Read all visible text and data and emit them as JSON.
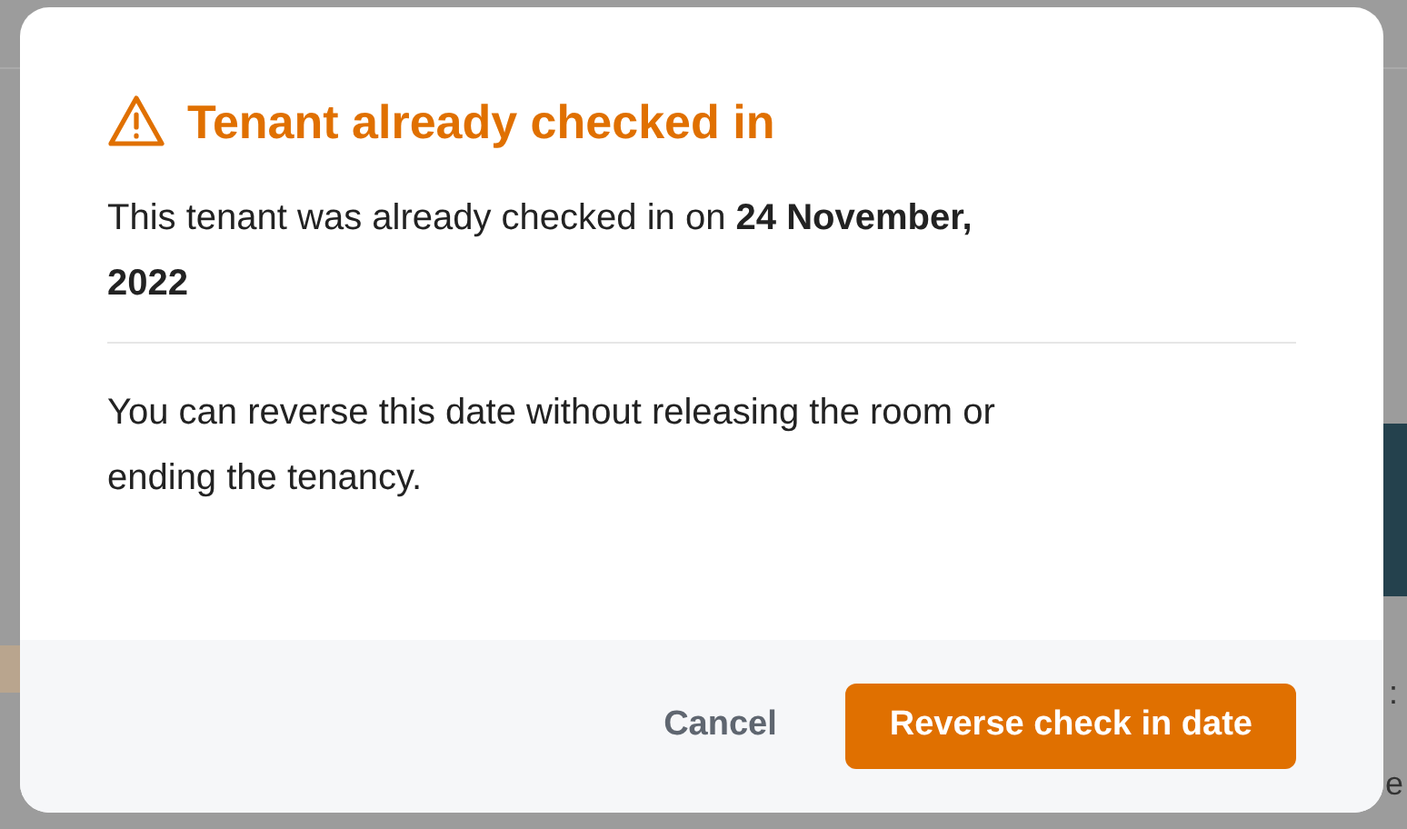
{
  "background": {
    "fragments_right": [
      {
        "text": ":",
        "kind": "plain"
      },
      {
        "text": "e",
        "kind": "plain"
      }
    ]
  },
  "dialog": {
    "title": "Tenant already checked in",
    "message": "This tenant was already checked in on **24 November, 2022**",
    "note": "You can reverse this date without releasing the room or ending the tenancy.",
    "buttons": [
      {
        "label": "Cancel",
        "kind": "secondary"
      },
      {
        "label": "Reverse check in date",
        "kind": "primary"
      }
    ]
  }
}
